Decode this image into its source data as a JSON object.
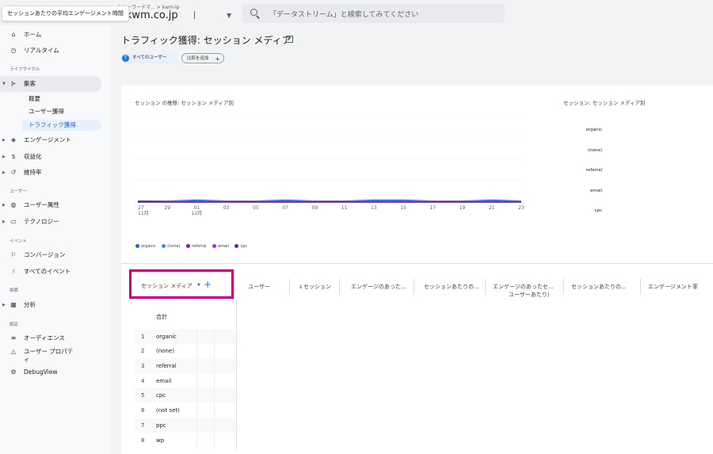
{
  "tooltip": "セッションあたりの平均エンゲージメント時間",
  "header": {
    "breadcrumb": "ミキーワードマ...  >  kwm-lp",
    "account": "v.kwm.co.jp",
    "search_placeholder": "「データストリーム」と検索してみてください"
  },
  "sidebar": {
    "home": "ホーム",
    "realtime": "リアルタイム",
    "section_lifecycle": "ライフサイクル",
    "acquisition": "集客",
    "acq_sub": [
      "概要",
      "ユーザー獲得",
      "トラフィック獲得"
    ],
    "engagement": "エンゲージメント",
    "monetization": "収益化",
    "retention": "維持率",
    "section_user": "ユーザー",
    "user_attributes": "ユーザー属性",
    "technology": "テクノロジー",
    "section_event": "イベント",
    "conversions": "コンバージョン",
    "all_events": "すべてのイベント",
    "section_explore": "探索",
    "analysis": "分析",
    "section_config": "設定",
    "audiences": "オーディエンス",
    "user_properties_1": "ユーザー プロパテ",
    "user_properties_2": "ィ",
    "debugview": "DebugView"
  },
  "main": {
    "title": "トラフィック獲得: セッション メディア",
    "chip_users_badge": "す",
    "chip_users": "すべてのユーザー",
    "chip_compare": "比較を追加"
  },
  "chart_data": {
    "type": "line",
    "title": "セッション の推移: セッション メディア別",
    "x": [
      "27",
      "29",
      "01",
      "03",
      "05",
      "07",
      "09",
      "11",
      "13",
      "15",
      "17",
      "19",
      "21",
      "23"
    ],
    "x_sub": [
      "11月",
      "12月"
    ],
    "ylim": [
      0,
      100
    ],
    "series": [
      {
        "name": "organic",
        "color": "#1967d2",
        "values": [
          2,
          2,
          3,
          2,
          2,
          3,
          2,
          2,
          3,
          3,
          2,
          2,
          3,
          2
        ]
      },
      {
        "name": "(none)",
        "color": "#4285f4",
        "values": [
          1,
          2,
          2,
          2,
          2,
          2,
          2,
          2,
          2,
          2,
          2,
          2,
          2,
          2
        ]
      },
      {
        "name": "referral",
        "color": "#7b1fa2",
        "values": [
          1,
          1,
          1,
          1,
          1,
          1,
          1,
          1,
          1,
          1,
          1,
          1,
          1,
          1
        ]
      },
      {
        "name": "email",
        "color": "#9334e6",
        "values": [
          1,
          1,
          1,
          1,
          1,
          1,
          1,
          1,
          1,
          1,
          1,
          1,
          1,
          1
        ]
      },
      {
        "name": "cpc",
        "color": "#5f259f",
        "values": [
          1,
          1,
          1,
          1,
          1,
          1,
          1,
          1,
          1,
          1,
          1,
          1,
          1,
          1
        ]
      }
    ]
  },
  "right_chart": {
    "title": "セッション: セッション メディア別",
    "labels": [
      "organic",
      "(none)",
      "referral",
      "email",
      "cpc"
    ]
  },
  "table": {
    "dimension": "セッション メディア",
    "columns": [
      "ユーザー",
      "↓セッション",
      "エンゲージのあった...",
      "セッションあたりの...",
      "エンゲージのあったセ...",
      "セッションあたりの...",
      "エンゲージメント率"
    ],
    "column5_sub": "ユーザーあたり）",
    "total_label": "合計",
    "rows": [
      {
        "num": "1",
        "name": "organic"
      },
      {
        "num": "2",
        "name": "(none)"
      },
      {
        "num": "3",
        "name": "referral"
      },
      {
        "num": "4",
        "name": "email"
      },
      {
        "num": "5",
        "name": "cpc"
      },
      {
        "num": "6",
        "name": "(not set)"
      },
      {
        "num": "7",
        "name": "ppc"
      },
      {
        "num": "8",
        "name": "wp"
      }
    ]
  }
}
